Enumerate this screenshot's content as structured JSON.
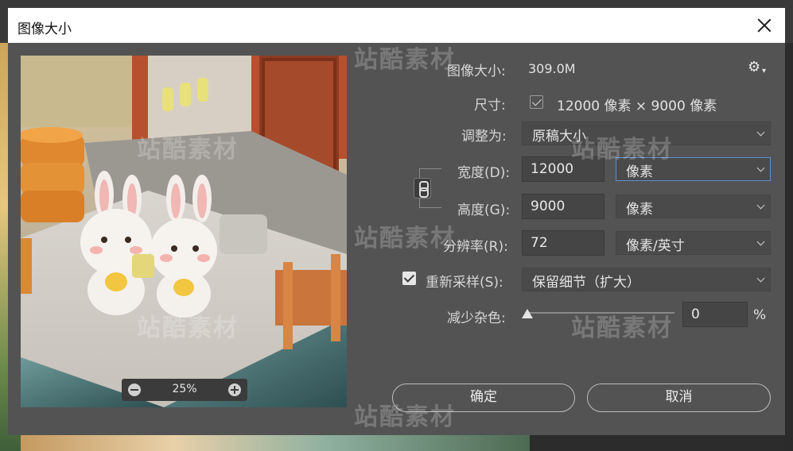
{
  "dialog": {
    "title": "图像大小"
  },
  "preview": {
    "zoom": "25%"
  },
  "form": {
    "image_size_label": "图像大小:",
    "image_size_value": "309.0M",
    "dimensions_label": "尺寸:",
    "dimensions_value": "12000 像素  ×  9000 像素",
    "fit_to_label": "调整为:",
    "fit_to_value": "原稿大小",
    "width_label": "宽度(D):",
    "width_value": "12000",
    "width_unit": "像素",
    "height_label": "高度(G):",
    "height_value": "9000",
    "height_unit": "像素",
    "resolution_label": "分辨率(R):",
    "resolution_value": "72",
    "resolution_unit": "像素/英寸",
    "resample_label": "重新采样(S):",
    "resample_checked": true,
    "resample_value": "保留细节（扩大）",
    "noise_label": "减少杂色:",
    "noise_value": "0",
    "noise_unit": "%",
    "noise_level": 0
  },
  "buttons": {
    "ok": "确定",
    "cancel": "取消"
  },
  "watermark": {
    "text": "站酷素材"
  },
  "icons": [
    "close-icon",
    "gear-icon",
    "link-chain-icon",
    "zoom-out-icon",
    "zoom-in-icon",
    "checkbox-icon",
    "chevron-down-icon"
  ],
  "colors": {
    "dialog_bg": "#535353",
    "titlebar_bg": "#ffffff",
    "focus_border": "#5e8ccc"
  }
}
